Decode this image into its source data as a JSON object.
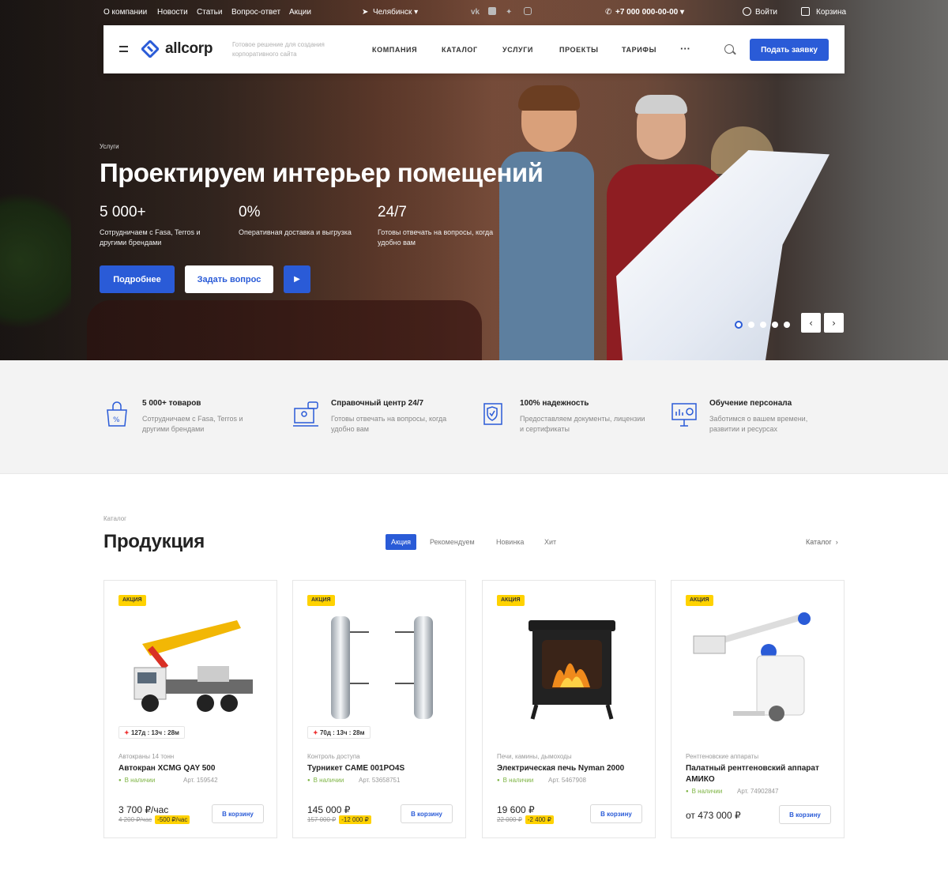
{
  "topbar": {
    "links": [
      "О компании",
      "Новости",
      "Статьи",
      "Вопрос-ответ",
      "Акции"
    ],
    "city": "Челябинск",
    "phone": "+7 000 000-00-00",
    "login": "Войти",
    "cart": "Корзина",
    "social_icons": [
      "vk-icon",
      "facebook-icon",
      "twitter-icon",
      "instagram-icon"
    ]
  },
  "header": {
    "logo": "allcorp",
    "tagline": "Готовое решение для создания корпоративного сайта",
    "nav": [
      "Компания",
      "Каталог",
      "Услуги",
      "Проекты",
      "Тарифы"
    ],
    "more": "···",
    "cta": "Подать заявку"
  },
  "hero": {
    "label": "Услуги",
    "title": "Проектируем интерьер помещений",
    "stats": [
      {
        "num": "5 000+",
        "text": "Сотрудничаем с Fasa, Terros и другими брендами"
      },
      {
        "num": "0%",
        "text": "Оперативная доставка и выгрузка"
      },
      {
        "num": "24/7",
        "text": "Готовы отвечать на вопросы, когда удобно вам"
      }
    ],
    "btn_more": "Подробнее",
    "btn_ask": "Задать вопрос",
    "btn_play": "▶",
    "slides_total": 5,
    "slide_active": 1,
    "prev": "‹",
    "next": "›"
  },
  "features": [
    {
      "icon": "shopping-bag-icon",
      "title": "5 000+ товаров",
      "text": "Сотрудничаем с Fasa, Terros и другими брендами"
    },
    {
      "icon": "support-center-icon",
      "title": "Справочный центр 24/7",
      "text": "Готовы отвечать на вопросы, когда удобно вам"
    },
    {
      "icon": "certificate-shield-icon",
      "title": "100% надежность",
      "text": "Предоставляем документы, лицензии и сертификаты"
    },
    {
      "icon": "presentation-board-icon",
      "title": "Обучение персонала",
      "text": "Заботимся о вашем времени, развитии и ресурсах"
    }
  ],
  "catalog": {
    "breadcrumb": "Каталог",
    "title": "Продукция",
    "tabs": [
      "Акция",
      "Рекомендуем",
      "Новинка",
      "Хит"
    ],
    "active_tab": 0,
    "link": "Каталог",
    "products": [
      {
        "badge": "Акция",
        "timer": "127д : 13ч : 28м",
        "category": "Автокраны 14 тонн",
        "name": "Автокран XCMG QAY 500",
        "stock": "В наличии",
        "art": "Арт. 159542",
        "price": "3 700 ₽/час",
        "old_price": "4 200 ₽/час",
        "discount": "-500 ₽/час",
        "cart": "В корзину"
      },
      {
        "badge": "Акция",
        "timer": "70д : 13ч : 28м",
        "category": "Контроль доступа",
        "name": "Турникет CAME 001PO4S",
        "stock": "В наличии",
        "art": "Арт. 53658751",
        "price": "145 000 ₽",
        "old_price": "157 000 ₽",
        "discount": "-12 000 ₽",
        "cart": "В корзину"
      },
      {
        "badge": "Акция",
        "timer": "",
        "category": "Печи, камины, дымоходы",
        "name": "Электрическая печь Nyman 2000",
        "stock": "В наличии",
        "art": "Арт. 5467908",
        "price": "19 600 ₽",
        "old_price": "22 000 ₽",
        "discount": "-2 400 ₽",
        "cart": "В корзину"
      },
      {
        "badge": "Акция",
        "timer": "",
        "category": "Рентгеновские аппараты",
        "name": "Палатный рентгеновский аппарат АМИКО",
        "stock": "В наличии",
        "art": "Арт. 74902847",
        "price": "от 473 000 ₽",
        "old_price": "",
        "discount": "",
        "cart": "В корзину"
      }
    ]
  },
  "colors": {
    "accent": "#2a5bd7",
    "badge": "#ffd200",
    "stock": "#7cb342",
    "sale_timer": "#e33333"
  }
}
